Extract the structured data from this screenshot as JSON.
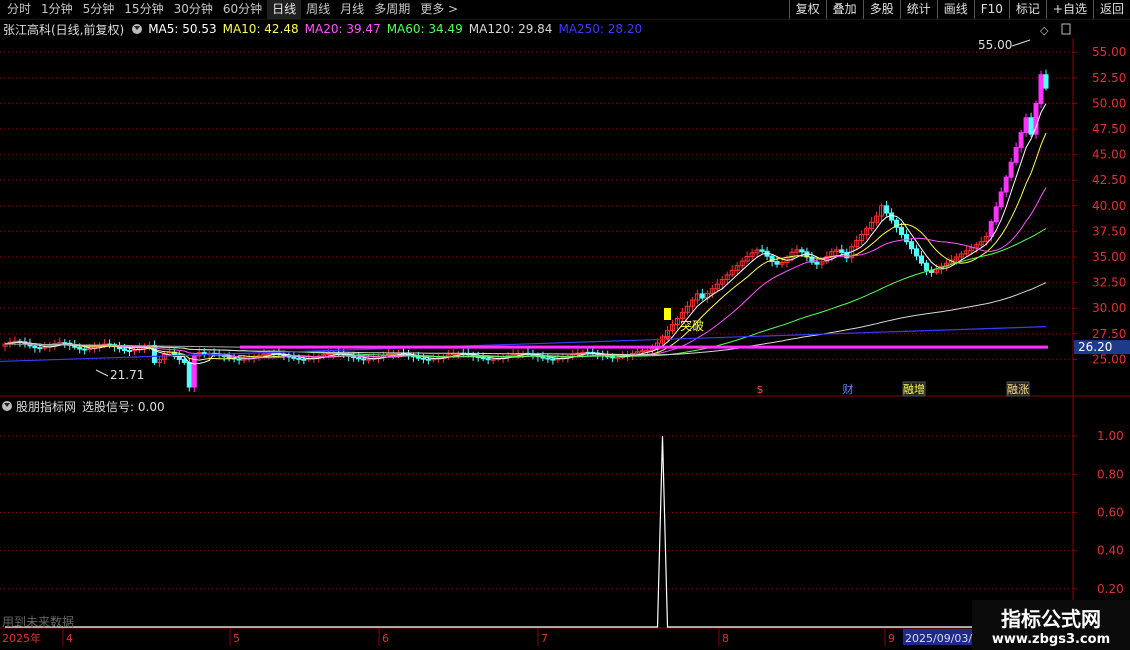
{
  "toolbar": {
    "periods": [
      "分时",
      "1分钟",
      "5分钟",
      "15分钟",
      "30分钟",
      "60分钟",
      "日线",
      "周线",
      "月线",
      "多周期",
      "更多 >"
    ],
    "active_period": "日线",
    "buttons": [
      "复权",
      "叠加",
      "多股",
      "统计",
      "画线",
      "F10",
      "标记",
      "+自选",
      "返回"
    ]
  },
  "main_header": {
    "title": "张江高科(日线,前复权)",
    "ma": [
      {
        "label": "MA5: 50.53",
        "color": "#ffffff"
      },
      {
        "label": "MA10: 42.48",
        "color": "#ffff54"
      },
      {
        "label": "MA20: 39.47",
        "color": "#ff54ff"
      },
      {
        "label": "MA60: 34.49",
        "color": "#54ff54"
      },
      {
        "label": "MA120: 29.84",
        "color": "#d8d8d8"
      },
      {
        "label": "MA250: 28.20",
        "color": "#3b3bff"
      }
    ]
  },
  "indicator_header": {
    "name": "股朋指标网",
    "signal": "选股信号: 0.00"
  },
  "bottom_note": "用到未来数据",
  "watermark": {
    "line1": "指标公式网",
    "line2": "www.zbgs3.com"
  },
  "colors": {
    "up": "#ff3232",
    "down": "#54ffff",
    "bigup": "#ff33ff",
    "line": "#ff33ff",
    "grid": "#8b0000",
    "axis": "#8b0000"
  },
  "chart_data": [
    {
      "type": "candlestick",
      "title": "张江高科(日线,前复权)",
      "ylim": [
        22.5,
        56
      ],
      "yticks": [
        25.0,
        27.5,
        30.0,
        32.5,
        35.0,
        37.5,
        40.0,
        42.5,
        45.0,
        47.5,
        50.0,
        52.5,
        55.0
      ],
      "price_tag": "26.20",
      "support_level": 26.2,
      "annotations": {
        "high": "55.00",
        "low": "21.71",
        "breakout": "突破"
      },
      "event_labels": [
        "$",
        "财",
        "融增",
        "融涨"
      ],
      "x_labels": [
        "2025年",
        "4",
        "5",
        "6",
        "7",
        "8",
        "9",
        "2025/09/03/"
      ]
    },
    {
      "type": "line",
      "title": "股朋指标网 选股信号",
      "ylim": [
        0,
        1.1
      ],
      "yticks": [
        0.2,
        0.4,
        0.6,
        0.8,
        1.0
      ],
      "signal": [
        0,
        0,
        0,
        0,
        0,
        0,
        0,
        0,
        0,
        0,
        0,
        0,
        0,
        0,
        0,
        0,
        0,
        0,
        0,
        0,
        0,
        0,
        0,
        0,
        0,
        0,
        0,
        0,
        0,
        0,
        0,
        0,
        0,
        0,
        0,
        0,
        0,
        0,
        0,
        0,
        0,
        0,
        0,
        0,
        0,
        0,
        0,
        0,
        0,
        0,
        0,
        0,
        0,
        0,
        0,
        0,
        0,
        0,
        0,
        0,
        0,
        0,
        0,
        0,
        0,
        0,
        0,
        0,
        0,
        0,
        0,
        0,
        0,
        0,
        0,
        0,
        0,
        0,
        0,
        0,
        0,
        0,
        0,
        0,
        0,
        0,
        0,
        0,
        0,
        0,
        0,
        0,
        0,
        0,
        0,
        0,
        0,
        0,
        0,
        0,
        0,
        0,
        0,
        0,
        0,
        0,
        0,
        0,
        0,
        0,
        0,
        0,
        0,
        0,
        0,
        0,
        0,
        0,
        0,
        0,
        0,
        0,
        0,
        0,
        0,
        0,
        0,
        0,
        0,
        0,
        0,
        0,
        1,
        0,
        0,
        0,
        0,
        0,
        0,
        0,
        0,
        0,
        0,
        0,
        0,
        0,
        0,
        0,
        0,
        0,
        0,
        0,
        0,
        0,
        0,
        0,
        0,
        0,
        0,
        0,
        0,
        0,
        0,
        0,
        0,
        0,
        0,
        0,
        0,
        0,
        0,
        0,
        0,
        0,
        0,
        0,
        0,
        0,
        0,
        0,
        0,
        0,
        0,
        0,
        0,
        0,
        0,
        0,
        0,
        0,
        0,
        0,
        0,
        0,
        0,
        0,
        0,
        0,
        0,
        0,
        0,
        0,
        0,
        0,
        0,
        0,
        0,
        0
      ]
    }
  ]
}
